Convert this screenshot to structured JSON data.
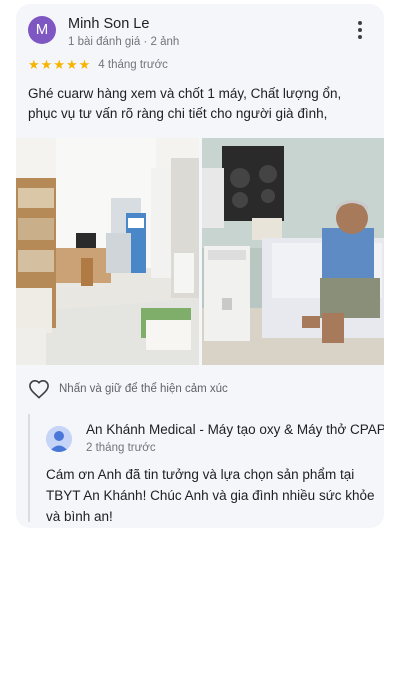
{
  "review": {
    "avatar_letter": "M",
    "reviewer_name": "Minh Son Le",
    "reviewer_meta": "1 bài đánh giá · 2 ảnh",
    "rating": 5,
    "time_ago": "4 tháng trước",
    "text": "Ghé cuarw hàng xem và chốt 1 máy, Chất lượng ổn, phục vụ tư vấn rõ ràng chi tiết cho người già đình,"
  },
  "reaction": {
    "hint": "Nhấn và giữ để thể hiện cảm xúc"
  },
  "reply": {
    "owner_name": "An Khánh Medical - Máy tạo oxy & Máy thở CPAP",
    "time_ago": "2 tháng trước",
    "text": "Cám ơn Anh đã tin tưởng và lựa chọn sản phẩm tại TBYT An Khánh! Chúc Anh và gia đình nhiều sức khỏe và bình an!"
  },
  "colors": {
    "avatar": "#7e57c2",
    "star": "#f6b400",
    "card_bg": "#f5f6fa"
  },
  "icons": {
    "more": "more-vert-icon",
    "heart": "heart-outline-icon",
    "reply_avatar": "person-icon"
  }
}
